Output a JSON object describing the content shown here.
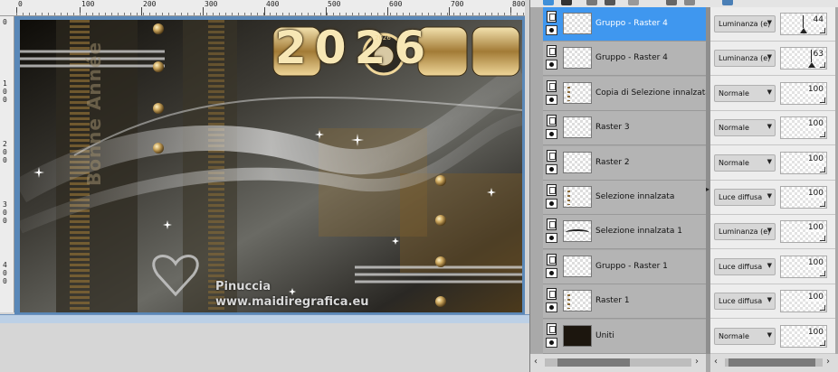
{
  "canvas": {
    "ruler_top_labels": [
      "0",
      "100",
      "200",
      "300",
      "400",
      "500",
      "600",
      "700",
      "800"
    ],
    "ruler_left_labels": [
      "0",
      "1\n0\n0",
      "2\n0\n0",
      "3\n0\n0",
      "4\n0\n0"
    ],
    "artwork": {
      "year_text": "2026",
      "clock_text": "2026",
      "vertical_text": "Bonne Année",
      "signature": "Pinuccia",
      "website": "www.maidiregrafica.eu"
    }
  },
  "layers": [
    {
      "name": "Gruppo - Raster 4",
      "blend": "Luminanza (e)",
      "opacity": 44,
      "selected": true,
      "thumb": "blank"
    },
    {
      "name": "Gruppo - Raster 4",
      "blend": "Luminanza (e)",
      "opacity": 63,
      "selected": false,
      "thumb": "blank"
    },
    {
      "name": "Copia di Selezione innalzata",
      "blend": "Normale",
      "opacity": 100,
      "selected": false,
      "thumb": "dots"
    },
    {
      "name": "Raster 3",
      "blend": "Normale",
      "opacity": 100,
      "selected": false,
      "thumb": "blank"
    },
    {
      "name": "Raster 2",
      "blend": "Normale",
      "opacity": 100,
      "selected": false,
      "thumb": "blank"
    },
    {
      "name": "Selezione innalzata",
      "blend": "Luce diffusa",
      "opacity": 100,
      "selected": false,
      "thumb": "dots"
    },
    {
      "name": "Selezione innalzata 1",
      "blend": "Luminanza (e)",
      "opacity": 100,
      "selected": false,
      "thumb": "swoosh"
    },
    {
      "name": "Gruppo - Raster 1",
      "blend": "Luce diffusa",
      "opacity": 100,
      "selected": false,
      "thumb": "blank"
    },
    {
      "name": "Raster 1",
      "blend": "Luce diffusa",
      "opacity": 100,
      "selected": false,
      "thumb": "dots"
    },
    {
      "name": "Uniti",
      "blend": "Normale",
      "opacity": 100,
      "selected": false,
      "thumb": "dark"
    }
  ],
  "icons": {
    "layer_type": "raster-layer-icon",
    "visibility": "eye-icon",
    "dropdown": "chevron-down-icon"
  },
  "colors": {
    "selected_row": "#3f97ef",
    "gold": "#c9a45c",
    "image_frame": "#5a88b8"
  }
}
